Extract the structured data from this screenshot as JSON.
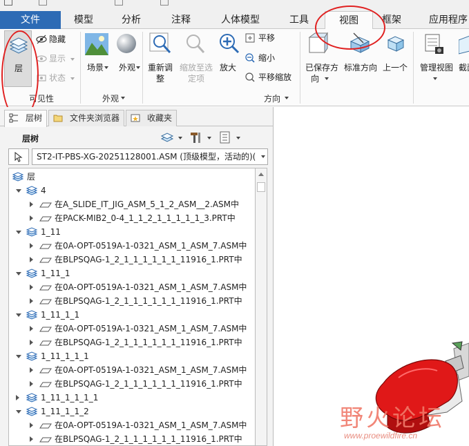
{
  "ribbon_tabs": [
    {
      "label": "文件"
    },
    {
      "label": "模型"
    },
    {
      "label": "分析"
    },
    {
      "label": "注释"
    },
    {
      "label": "人体模型"
    },
    {
      "label": "工具"
    },
    {
      "label": "视图"
    },
    {
      "label": "框架"
    },
    {
      "label": "应用程序"
    }
  ],
  "ribbon": {
    "layers_label": "层",
    "hide_label": "隐藏",
    "show_label": "显示",
    "status_label": "状态",
    "visibility_group": "可见性",
    "scene_label": "场景",
    "appearance_label": "外观",
    "appearance_group": "外观",
    "refit_label_1": "重新调",
    "refit_label_2": "整",
    "zoom_selected_1": "缩放至选",
    "zoom_selected_2": "定项",
    "zoom_in_label": "放大",
    "pan_label": "平移",
    "zoom_out_label": "缩小",
    "pan_zoom_label": "平移缩放",
    "saved_orient_1": "已保存方",
    "saved_orient_2": "向",
    "standard_orient": "标准方向",
    "previous_label": "上一个",
    "orientation_group": "方向",
    "manage_views": "管理视图",
    "section_label": "截面"
  },
  "panel": {
    "tabs": [
      {
        "label": "层树"
      },
      {
        "label": "文件夹浏览器"
      },
      {
        "label": "收藏夹"
      }
    ],
    "tree_title": "层树",
    "model_select": "ST2-IT-PBS-XG-20251128001.ASM (顶级模型，活动的)(",
    "tree_rows": [
      {
        "text": "层",
        "level": 0,
        "expander": "none",
        "icon": "layers-root-icon"
      },
      {
        "text": "4",
        "level": 1,
        "expander": "open",
        "icon": "layer-icon"
      },
      {
        "text": "在A_SLIDE_IT_JIG_ASM_5_1_2_ASM__2.ASM中",
        "level": 2,
        "expander": "closed",
        "icon": "layer-item-icon"
      },
      {
        "text": "在PACK-MIB2_0-4_1_1_2_1_1_1_1_1_3.PRT中",
        "level": 2,
        "expander": "closed",
        "icon": "layer-item-icon"
      },
      {
        "text": "1_11",
        "level": 1,
        "expander": "open",
        "icon": "layer-icon"
      },
      {
        "text": "在0A-OPT-0519A-1-0321_ASM_1_ASM_7.ASM中",
        "level": 2,
        "expander": "closed",
        "icon": "layer-item-icon"
      },
      {
        "text": "在BLPSQAG-1_2_1_1_1_1_1_1_11916_1.PRT中",
        "level": 2,
        "expander": "closed",
        "icon": "layer-item-icon"
      },
      {
        "text": "1_11_1",
        "level": 1,
        "expander": "open",
        "icon": "layer-icon"
      },
      {
        "text": "在0A-OPT-0519A-1-0321_ASM_1_ASM_7.ASM中",
        "level": 2,
        "expander": "closed",
        "icon": "layer-item-icon"
      },
      {
        "text": "在BLPSQAG-1_2_1_1_1_1_1_1_11916_1.PRT中",
        "level": 2,
        "expander": "closed",
        "icon": "layer-item-icon"
      },
      {
        "text": "1_11_1_1",
        "level": 1,
        "expander": "open",
        "icon": "layer-icon"
      },
      {
        "text": "在0A-OPT-0519A-1-0321_ASM_1_ASM_7.ASM中",
        "level": 2,
        "expander": "closed",
        "icon": "layer-item-icon"
      },
      {
        "text": "在BLPSQAG-1_2_1_1_1_1_1_1_11916_1.PRT中",
        "level": 2,
        "expander": "closed",
        "icon": "layer-item-icon"
      },
      {
        "text": "1_11_1_1_1",
        "level": 1,
        "expander": "open",
        "icon": "layer-icon"
      },
      {
        "text": "在0A-OPT-0519A-1-0321_ASM_1_ASM_7.ASM中",
        "level": 2,
        "expander": "closed",
        "icon": "layer-item-icon"
      },
      {
        "text": "在BLPSQAG-1_2_1_1_1_1_1_1_11916_1.PRT中",
        "level": 2,
        "expander": "closed",
        "icon": "layer-item-icon"
      },
      {
        "text": "1_11_1_1_1_1",
        "level": 1,
        "expander": "closed",
        "icon": "layer-icon"
      },
      {
        "text": "1_11_1_1_2",
        "level": 1,
        "expander": "open",
        "icon": "layer-icon"
      },
      {
        "text": "在0A-OPT-0519A-1-0321_ASM_1_ASM_7.ASM中",
        "level": 2,
        "expander": "closed",
        "icon": "layer-item-icon"
      },
      {
        "text": "在BLPSQAG-1_2_1_1_1_1_1_1_11916_1.PRT中",
        "level": 2,
        "expander": "closed",
        "icon": "layer-item-icon"
      }
    ]
  },
  "watermark": {
    "title": "野火论坛",
    "url": "www.proewildfire.cn"
  },
  "colors": {
    "file_tab": "#2d6bb5",
    "annotation_circle": "#e02020",
    "model_red": "#e01818"
  }
}
